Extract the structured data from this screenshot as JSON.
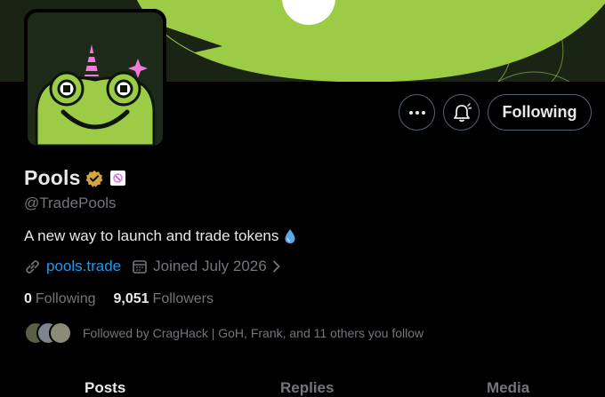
{
  "colors": {
    "background": "#000000",
    "text_primary": "#e7e9ea",
    "text_secondary": "#71767b",
    "link": "#1d9bf0",
    "banner_green": "#9ccb45",
    "verified_gold": "#d6a539"
  },
  "banner": {
    "description_icon": "lily-pad-banner"
  },
  "avatar": {
    "icon": "frog-unicorn-avatar"
  },
  "actions": {
    "more_icon": "more-icon",
    "bell_icon": "notification-bell-icon",
    "following_label": "Following"
  },
  "profile": {
    "display_name": "Pools",
    "verified_icon": "verified-badge-icon",
    "affiliate_icon": "affiliate-badge-icon",
    "handle": "@TradePools",
    "bio": "A new way to launch and trade tokens",
    "bio_emoji": "droplet-icon",
    "website": "pools.trade",
    "joined": "Joined July 2026"
  },
  "stats": {
    "following_count": "0",
    "following_label": "Following",
    "followers_count": "9,051",
    "followers_label": "Followers"
  },
  "followed_by": {
    "text": "Followed by CragHack | GoH, Frank, and 11 others you follow"
  },
  "tabs": [
    {
      "label": "Posts"
    },
    {
      "label": "Replies"
    },
    {
      "label": "Media"
    }
  ]
}
